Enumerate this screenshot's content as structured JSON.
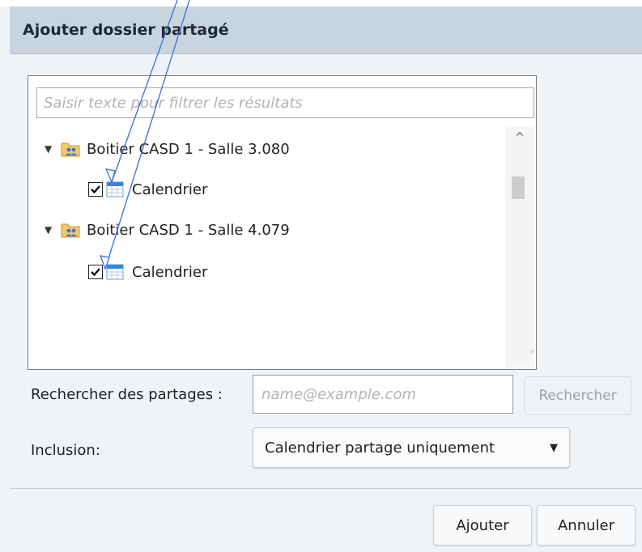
{
  "dialog": {
    "title": "Ajouter dossier partagé"
  },
  "filter": {
    "placeholder": "Saisir texte pour filtrer les résultats",
    "value": ""
  },
  "tree": {
    "groups": [
      {
        "label": "Boitier CASD 1 - Salle 3.080",
        "expanded": true,
        "children": [
          {
            "label": "Calendrier",
            "checked": true
          }
        ]
      },
      {
        "label": "Boitier CASD 1 - Salle 4.079",
        "expanded": true,
        "children": [
          {
            "label": "Calendrier",
            "checked": true
          }
        ]
      }
    ]
  },
  "search": {
    "label": "Rechercher des partages :",
    "placeholder": "name@example.com",
    "value": "",
    "button_label": "Rechercher"
  },
  "inclusion": {
    "label": "Inclusion:",
    "selected": "Calendrier partage uniquement"
  },
  "footer": {
    "add_label": "Ajouter",
    "cancel_label": "Annuler"
  },
  "icons": {
    "expand": "triangle-down-icon",
    "group": "shared-folder-icon",
    "item": "calendar-icon",
    "checkbox": "checkmark-icon",
    "select": "caret-down-icon"
  },
  "colors": {
    "header_bg": "#c8d5df",
    "dialog_bg": "#eef3f7",
    "annotation_arrow": "#3a6fd8"
  }
}
